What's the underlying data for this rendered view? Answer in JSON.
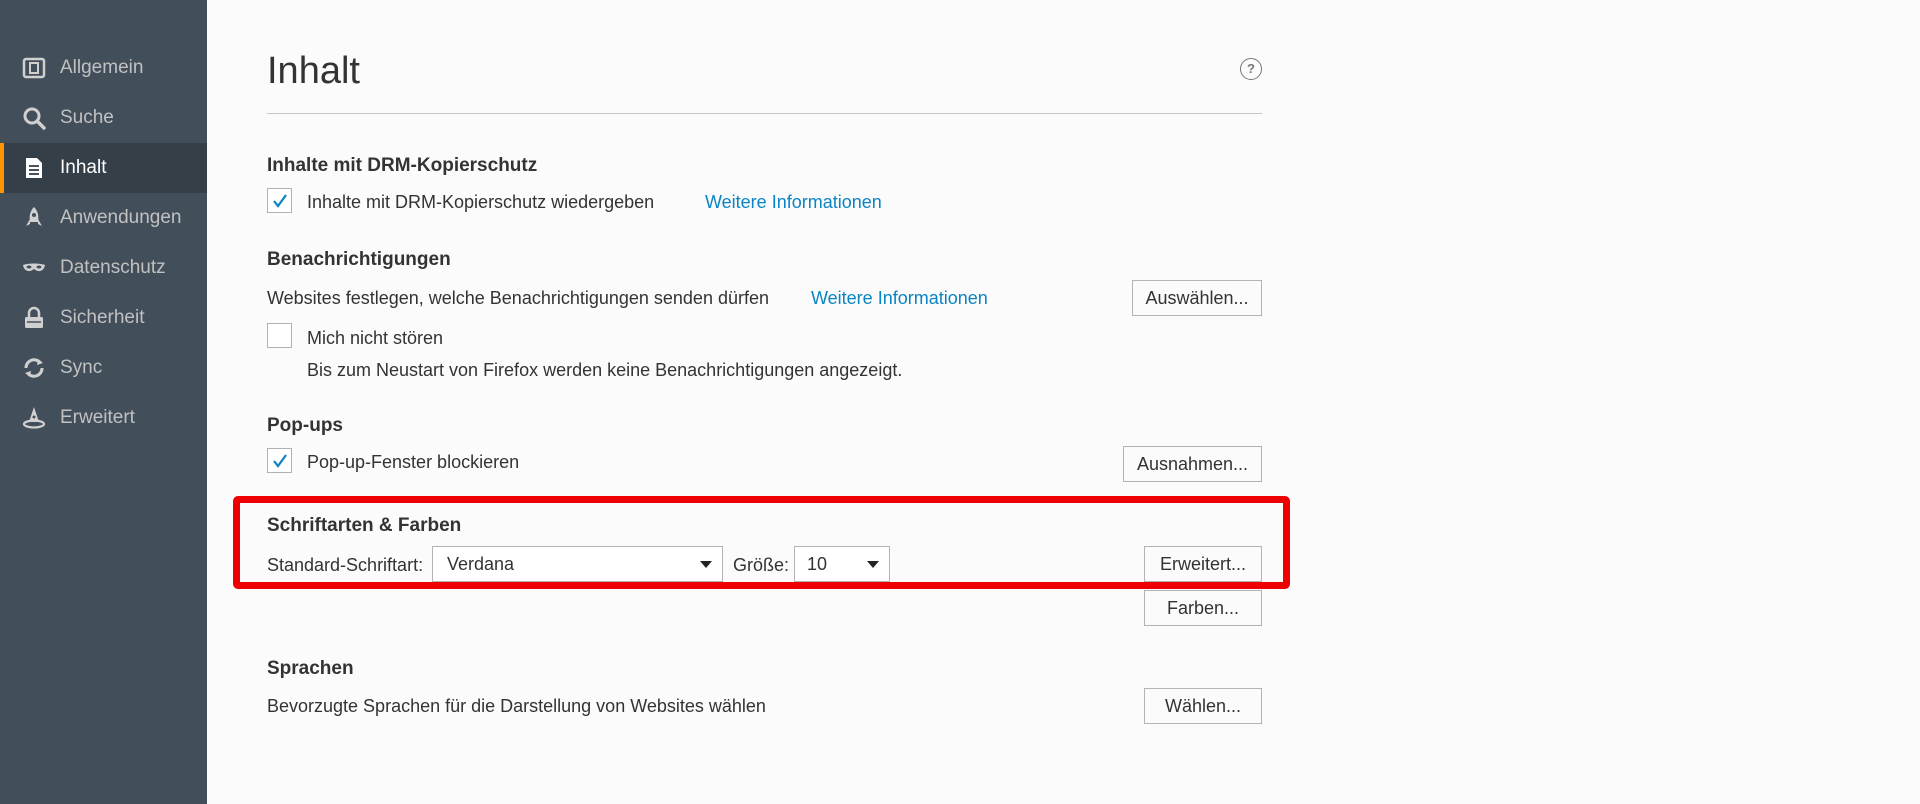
{
  "sidebar": {
    "items": [
      {
        "label": "Allgemein",
        "icon": "general-icon"
      },
      {
        "label": "Suche",
        "icon": "search-icon"
      },
      {
        "label": "Inhalt",
        "icon": "content-icon",
        "selected": true
      },
      {
        "label": "Anwendungen",
        "icon": "applications-icon"
      },
      {
        "label": "Datenschutz",
        "icon": "privacy-mask-icon"
      },
      {
        "label": "Sicherheit",
        "icon": "security-lock-icon"
      },
      {
        "label": "Sync",
        "icon": "sync-icon"
      },
      {
        "label": "Erweitert",
        "icon": "advanced-wizard-hat-icon"
      }
    ]
  },
  "page": {
    "title": "Inhalt",
    "help_icon": "?"
  },
  "drm": {
    "heading": "Inhalte mit DRM-Kopierschutz",
    "checkbox_label": "Inhalte mit DRM-Kopierschutz wiedergeben",
    "checked": true,
    "link": "Weitere Informationen"
  },
  "notifications": {
    "heading": "Benachrichtigungen",
    "description": "Websites festlegen, welche Benachrichtigungen senden dürfen",
    "link": "Weitere Informationen",
    "button": "Auswählen...",
    "dnd_label": "Mich nicht stören",
    "dnd_checked": false,
    "dnd_note": "Bis zum Neustart von Firefox werden keine Benachrichtigungen angezeigt."
  },
  "popups": {
    "heading": "Pop-ups",
    "checkbox_label": "Pop-up-Fenster blockieren",
    "checked": true,
    "button": "Ausnahmen..."
  },
  "fonts": {
    "heading": "Schriftarten & Farben",
    "default_font_label": "Standard-Schriftart:",
    "default_font_value": "Verdana",
    "size_label": "Größe:",
    "size_value": "10",
    "advanced_button": "Erweitert...",
    "colors_button": "Farben..."
  },
  "languages": {
    "heading": "Sprachen",
    "description": "Bevorzugte Sprachen für die Darstellung von Websites wählen",
    "button": "Wählen..."
  },
  "colors": {
    "sidebar_bg": "#424f5a",
    "accent": "#ff9500",
    "link": "#0a84c3",
    "highlight": "#ee0000"
  }
}
